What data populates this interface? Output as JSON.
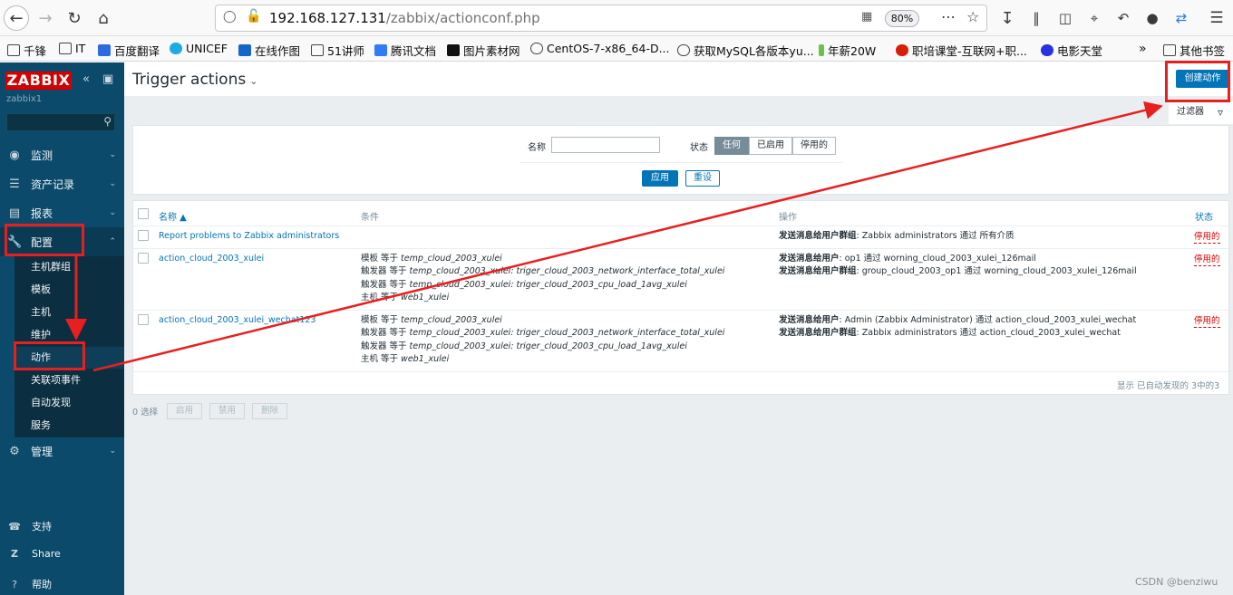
{
  "browser": {
    "url_host": "192.168.127.131",
    "url_path": "/zabbix/actionconf.php",
    "zoom": "80%",
    "bookmarks": [
      "千锋",
      "IT",
      "百度翻译",
      "UNICEF",
      "在线作图",
      "51讲师",
      "腾讯文档",
      "图片素材网",
      "CentOS-7-x86_64-D...",
      "获取MySQL各版本yu...",
      "年薪20W",
      "职培课堂-互联网+职...",
      "电影天堂"
    ],
    "other_bookmarks": "其他书签"
  },
  "sidebar": {
    "logo": "ZABBIX",
    "server": "zabbix1",
    "menu": [
      {
        "label": "监测",
        "icon": "eye-icon"
      },
      {
        "label": "资产记录",
        "icon": "list-icon"
      },
      {
        "label": "报表",
        "icon": "chart-icon"
      },
      {
        "label": "配置",
        "icon": "wrench-icon"
      }
    ],
    "config_sub": [
      "主机群组",
      "模板",
      "主机",
      "维护",
      "动作",
      "关联项事件",
      "自动发现",
      "服务"
    ],
    "admin": {
      "label": "管理",
      "icon": "gear-icon"
    },
    "bottom": [
      {
        "label": "支持",
        "icon": "support-icon"
      },
      {
        "label": "Share",
        "icon": "share-icon"
      },
      {
        "label": "帮助",
        "icon": "help-icon"
      }
    ]
  },
  "header": {
    "title": "Trigger actions",
    "create_button": "创建动作",
    "filter_tab": "过滤器"
  },
  "filter": {
    "name_label": "名称",
    "name_value": "",
    "status_label": "状态",
    "status_options": [
      "任何",
      "已启用",
      "停用的"
    ],
    "status_selected": "任何",
    "apply": "应用",
    "reset": "重设"
  },
  "table": {
    "columns": [
      "名称 ▲",
      "条件",
      "操作",
      "状态"
    ],
    "rows": [
      {
        "name": "Report problems to Zabbix administrators",
        "conditions": [],
        "operations": [
          {
            "k": "发送消息给用户群组",
            "v": ": Zabbix administrators 通过 所有介质"
          }
        ],
        "status": "停用的"
      },
      {
        "name": "action_cloud_2003_xulei",
        "conditions": [
          {
            "k": "模板 等于 ",
            "v": "temp_cloud_2003_xulei"
          },
          {
            "k": "触发器 等于 ",
            "v": "temp_cloud_2003_xulei: triger_cloud_2003_network_interface_total_xulei"
          },
          {
            "k": "触发器 等于 ",
            "v": "temp_cloud_2003_xulei: triger_cloud_2003_cpu_load_1avg_xulei"
          },
          {
            "k": "主机 等于 ",
            "v": "web1_xulei"
          }
        ],
        "operations": [
          {
            "k": "发送消息给用户",
            "v": ": op1 通过 worning_cloud_2003_xulei_126mail"
          },
          {
            "k": "发送消息给用户群组",
            "v": ": group_cloud_2003_op1 通过 worning_cloud_2003_xulei_126mail"
          }
        ],
        "status": "停用的"
      },
      {
        "name": "action_cloud_2003_xulei_wechat123",
        "conditions": [
          {
            "k": "模板 等于 ",
            "v": "temp_cloud_2003_xulei"
          },
          {
            "k": "触发器 等于 ",
            "v": "temp_cloud_2003_xulei: triger_cloud_2003_network_interface_total_xulei"
          },
          {
            "k": "触发器 等于 ",
            "v": "temp_cloud_2003_xulei: triger_cloud_2003_cpu_load_1avg_xulei"
          },
          {
            "k": "主机 等于 ",
            "v": "web1_xulei"
          }
        ],
        "operations": [
          {
            "k": "发送消息给用户",
            "v": ": Admin (Zabbix Administrator) 通过 action_cloud_2003_xulei_wechat"
          },
          {
            "k": "发送消息给用户群组",
            "v": ": Zabbix administrators 通过 action_cloud_2003_xulei_wechat"
          }
        ],
        "status": "停用的"
      }
    ],
    "footer": "显示 已自动发现的 3中的3"
  },
  "bulk": {
    "selected": "0 选择",
    "enable": "启用",
    "disable": "禁用",
    "delete": "删除"
  },
  "watermark": "CSDN @benziwu",
  "annotation_color": "#e81f1f"
}
